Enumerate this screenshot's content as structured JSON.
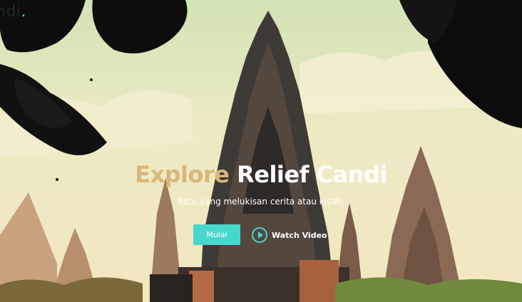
{
  "header": {
    "brand_text": "ndi",
    "brand_dot": "."
  },
  "hero": {
    "title_accent": "Explore",
    "title_main": "Relief Candi",
    "subtitle": "batu yang melukisan cerita atau kisah.",
    "primary_button_label": "Mulai",
    "video_button_label": "Watch Video"
  },
  "colors": {
    "accent": "#47d8cd",
    "title_accent": "#d9b77a",
    "sky": "#e9e7c2"
  },
  "icons": {
    "play": "play-icon"
  }
}
